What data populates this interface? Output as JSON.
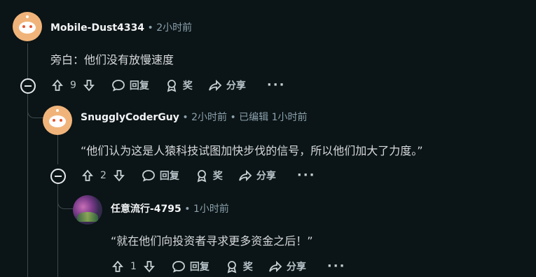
{
  "comments": [
    {
      "username": "Mobile-Dust4334",
      "time": "2小时前",
      "text": "旁白：他们没有放慢速度",
      "votes": "9",
      "reply_label": "回复",
      "award_label": "奖",
      "share_label": "分享",
      "more_label": "···"
    },
    {
      "username": "SnugglyCoderGuy",
      "time": "2小时前",
      "edited": "已编辑 1小时前",
      "text": "“他们认为这是人猿科技试图加快步伐的信号，所以他们加大了力度。”",
      "votes": "2",
      "reply_label": "回复",
      "award_label": "奖",
      "share_label": "分享",
      "more_label": "···"
    },
    {
      "username": "任意流行-4795",
      "time": "1小时前",
      "text": "“就在他们向投资者寻求更多资金之后！”",
      "votes": "1",
      "reply_label": "回复",
      "award_label": "奖",
      "share_label": "分享",
      "more_label": "···"
    }
  ]
}
